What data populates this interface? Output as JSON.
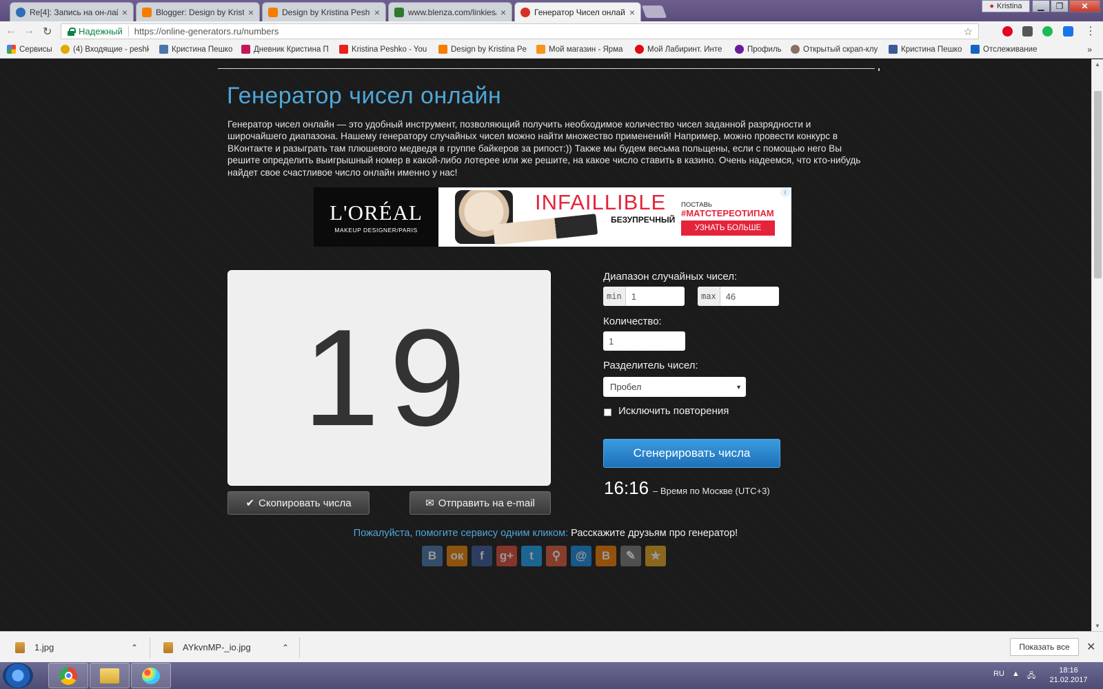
{
  "browser": {
    "tabs": [
      {
        "label": "Re[4]: Запись на он-лай",
        "favicon_color": "#2b6fb6"
      },
      {
        "label": "Blogger: Design by Kristi",
        "favicon_color": "#f57d00"
      },
      {
        "label": "Design by Kristina Peshk",
        "favicon_color": "#f57d00"
      },
      {
        "label": "www.blenza.com/linkies/",
        "favicon_color": "#2d7a2d"
      },
      {
        "label": "Генератор Чисел онлай",
        "favicon_color": "#d93025"
      }
    ],
    "user_name": "Kristina",
    "secure_label": "Надежный",
    "url": "https://online-generators.ru/numbers",
    "bookmarks": [
      {
        "label": "Сервисы",
        "icon_color": "#4285f4"
      },
      {
        "label": "(4) Входящие - peshk",
        "icon_color": "#e0a800"
      },
      {
        "label": "Кристина Пешко",
        "icon_color": "#4a76a8"
      },
      {
        "label": "Дневник Кристина П",
        "icon_color": "#c2185b"
      },
      {
        "label": "Kristina Peshko - You",
        "icon_color": "#e62117"
      },
      {
        "label": "Design by Kristina Pe",
        "icon_color": "#f57d00"
      },
      {
        "label": "Мой магазин - Ярма",
        "icon_color": "#f7941d"
      },
      {
        "label": "Мой Лабиринт. Инте",
        "icon_color": "#e30613"
      },
      {
        "label": "Профиль",
        "icon_color": "#6a1b9a"
      },
      {
        "label": "Открытый скрап-клу",
        "icon_color": "#8d6e63"
      },
      {
        "label": "Кристина Пешко",
        "icon_color": "#3b5998"
      },
      {
        "label": "Отслеживание",
        "icon_color": "#1565c0"
      }
    ],
    "bookmarks_more": "»"
  },
  "page": {
    "title": "Генератор чисел онлайн",
    "intro": "Генератор чисел онлайн — это удобный инструмент, позволяющий получить необходимое количество чисел заданной разрядности и широчайшего диапазона. Нашему генератору случайных чисел можно найти множество применений! Например, можно провести конкурс в ВКонтакте и разыграть там плюшевого медведя в группе байкеров за рипост:)) Также мы будем весьма польщены, если с помощью него Вы решите определить выигрышный номер в какой-либо лотерее или же решите, на какое число ставить в казино. Очень надеемся, что кто-нибудь найдет свое счастливое число онлайн именно у нас!",
    "ad": {
      "brand": "L'ORÉAL",
      "brand_sub": "MAKEUP DESIGNER/PARIS",
      "headline": "INFAILLIBLE",
      "subline": "БЕЗУПРЕЧНЫЙ",
      "put": "ПОСТАВЬ",
      "hashtag": "#МАТСТЕРЕОТИПАМ",
      "button": "УЗНАТЬ БОЛЬШЕ",
      "info": "i"
    },
    "result": "19",
    "copy_button": "Скопировать числа",
    "copy_icon": "✔",
    "email_button": "Отправить на e-mail",
    "email_icon": "✉",
    "form": {
      "range_label": "Диапазон случайных чисел:",
      "min_addon": "min",
      "min_value": "1",
      "max_addon": "max",
      "max_value": "46",
      "count_label": "Количество:",
      "count_value": "1",
      "separator_label": "Разделитель чисел:",
      "separator_value": "Пробел",
      "exclude_label": "Исключить повторения",
      "exclude_checked": false,
      "generate_button": "Сгенерировать числа"
    },
    "clock": {
      "time": "16:16",
      "desc": "– Время по Москве (UTC+3)"
    },
    "share_prompt": "Пожалуйста, помогите сервису одним кликом:",
    "share_cta": "Расскажите друзьям про генератор!",
    "social": [
      {
        "name": "vkontakte-icon",
        "glyph": "В",
        "color": "#4a76a8"
      },
      {
        "name": "odnoklassniki-icon",
        "glyph": "ок",
        "color": "#ee8208"
      },
      {
        "name": "facebook-icon",
        "glyph": "f",
        "color": "#3b5998"
      },
      {
        "name": "google-plus-icon",
        "glyph": "g+",
        "color": "#dd4b39"
      },
      {
        "name": "twitter-icon",
        "glyph": "t",
        "color": "#1da1f2"
      },
      {
        "name": "moikrug-icon",
        "glyph": "⚲",
        "color": "#e05a3a"
      },
      {
        "name": "mailru-icon",
        "glyph": "@",
        "color": "#168de2"
      },
      {
        "name": "blogger-icon",
        "glyph": "B",
        "color": "#f57d00"
      },
      {
        "name": "livejournal-icon",
        "glyph": "✎",
        "color": "#7a7a7a"
      },
      {
        "name": "bookmark-star-icon",
        "glyph": "★",
        "color": "#e6a623"
      }
    ]
  },
  "downloads": {
    "items": [
      "1.jpg",
      "AYkvnMP-_io.jpg"
    ],
    "show_all": "Показать все"
  },
  "taskbar": {
    "lang": "RU",
    "time": "18:16",
    "date": "21.02.2017"
  }
}
